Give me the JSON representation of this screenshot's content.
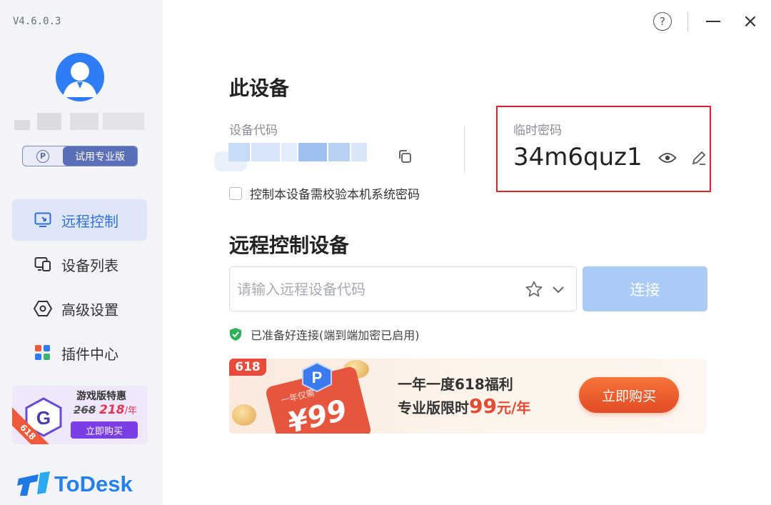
{
  "app": {
    "version": "V4.6.0.3",
    "brand_name": "ToDesk"
  },
  "sidebar": {
    "edition_label": "试用专业版",
    "edition_icon_letter": "P",
    "nav": [
      {
        "label": "远程控制",
        "icon": "remote-control-icon",
        "active": true
      },
      {
        "label": "设备列表",
        "icon": "device-list-icon",
        "active": false
      },
      {
        "label": "高级设置",
        "icon": "settings-hex-icon",
        "active": false
      },
      {
        "label": "插件中心",
        "icon": "plugin-grid-icon",
        "active": false
      }
    ],
    "promo": {
      "title": "游戏版特惠",
      "old_price": "268",
      "new_price": "218",
      "unit": "/年",
      "button": "立即购买",
      "ribbon": "618",
      "hex_letter": "G"
    }
  },
  "window_controls": {
    "help": "?",
    "close": "×"
  },
  "this_device": {
    "heading": "此设备",
    "device_code_label": "设备代码",
    "temp_password_label": "临时密码",
    "temp_password": "34m6quz1",
    "verify_checkbox_label": "控制本设备需校验本机系统密码",
    "verify_checked": false
  },
  "remote_control": {
    "heading": "远程控制设备",
    "input_placeholder": "请输入远程设备代码",
    "input_value": "",
    "connect_button": "连接",
    "status_text": "已准备好连接(端到端加密已启用)"
  },
  "banner": {
    "tag": "618",
    "line1": "一年一度618福利",
    "line2_prefix": "专业版限时",
    "line2_price": "99",
    "line2_unit": "元/年",
    "button": "立即购买",
    "phone_small": "一年仅需",
    "phone_price": "¥99",
    "badge_letter": "P"
  },
  "colors": {
    "accent": "#2f6fe0",
    "connect_disabled": "#a9cbf5",
    "highlight_border": "#d7252b",
    "brand": "#2680eb"
  }
}
